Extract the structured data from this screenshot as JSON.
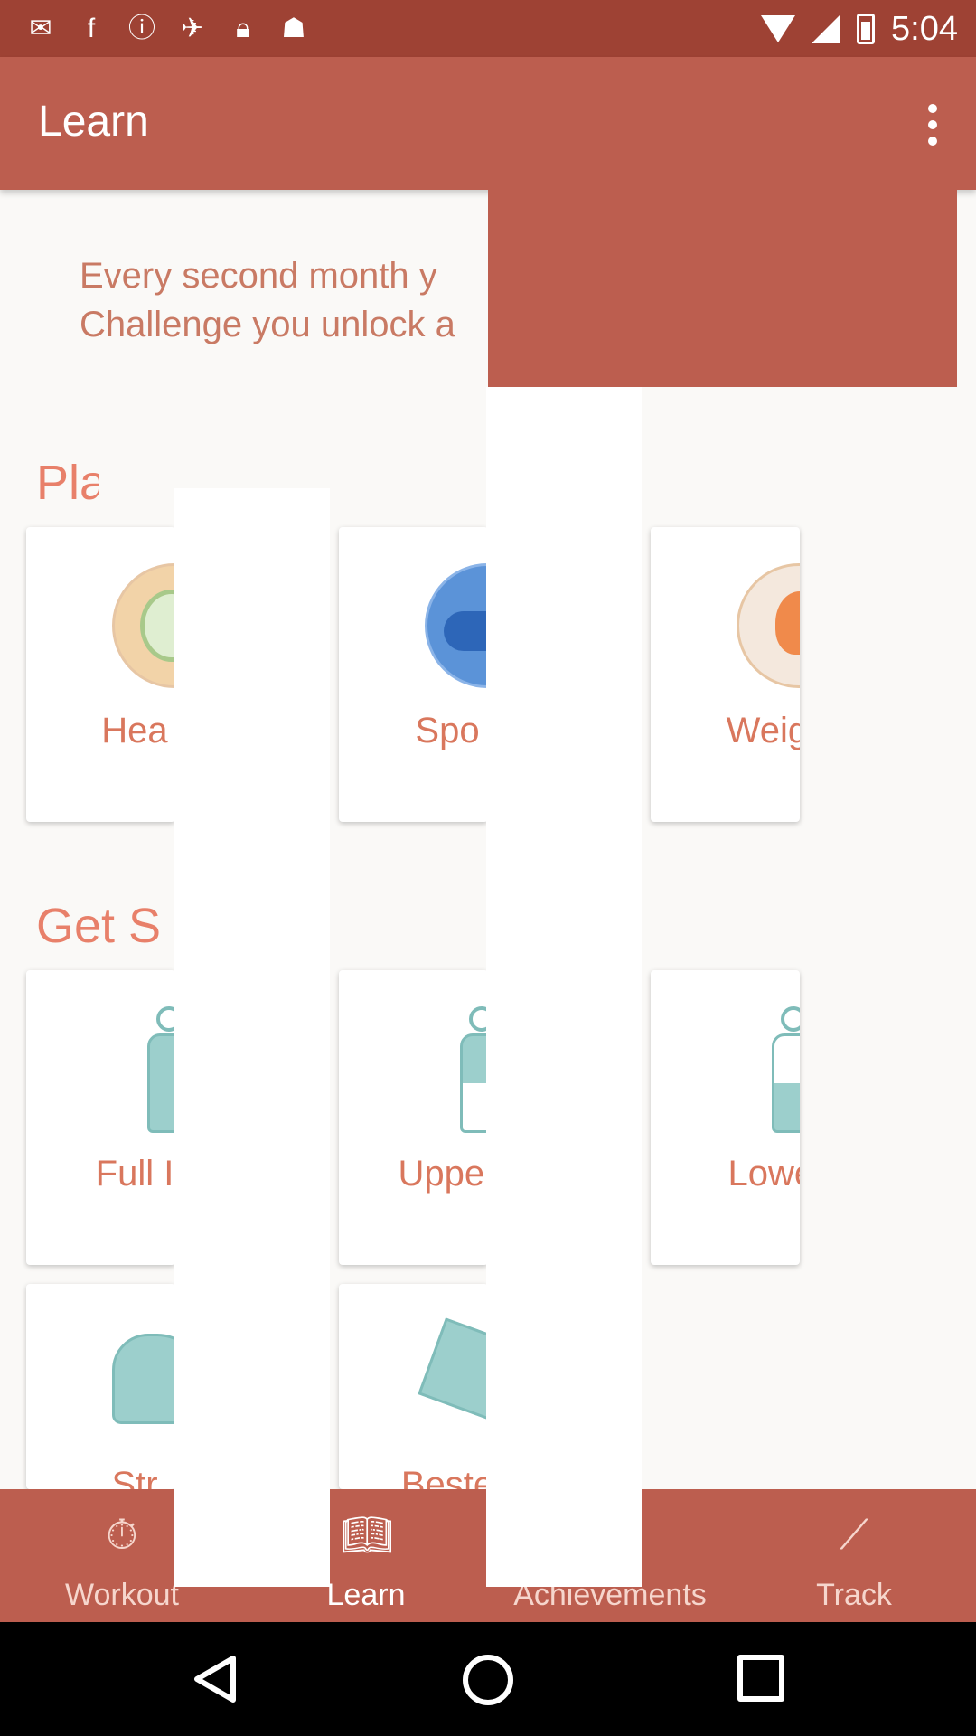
{
  "status_bar": {
    "time": "5:04",
    "icons": [
      "mail-icon",
      "facebook-icon",
      "alert-icon",
      "fake-gps-icon",
      "lock-icon",
      "android-icon"
    ]
  },
  "app_bar": {
    "title": "Learn"
  },
  "intro": {
    "line1": "Every second month y",
    "line2": "Challenge you unlock a"
  },
  "sections": {
    "plans_title": "Pla",
    "get_started_title": "Get S"
  },
  "plan_cards": [
    {
      "label": "Hea",
      "icon": "apple-icon"
    },
    {
      "label": "Spo",
      "icon": "sneaker-icon"
    },
    {
      "label": "Weigh",
      "icon": "fire-icon"
    }
  ],
  "start_cards": [
    {
      "label": "Full I",
      "icon": "full-body-figure-icon"
    },
    {
      "label": "Upper",
      "icon": "upper-body-figure-icon"
    },
    {
      "label": "Lower",
      "icon": "lower-body-figure-icon"
    }
  ],
  "extra_cards": [
    {
      "label": "Str",
      "icon": "stretching-figure-icon"
    },
    {
      "label": "Beste",
      "icon": "bootcamp-flag-icon"
    }
  ],
  "bottom_nav": [
    {
      "label": "Workout",
      "icon": "stopwatch-icon",
      "active": false
    },
    {
      "label": "Learn",
      "icon": "book-icon",
      "active": true
    },
    {
      "label": "Achievements",
      "icon": "trophy-icon",
      "active": false
    },
    {
      "label": "Track",
      "icon": "graph-line-icon",
      "active": false
    }
  ],
  "colors": {
    "status_bar": "#9e4234",
    "app_bar": "#bc5e4f",
    "accent_text": "#e8806a",
    "background": "#faf9f7"
  }
}
